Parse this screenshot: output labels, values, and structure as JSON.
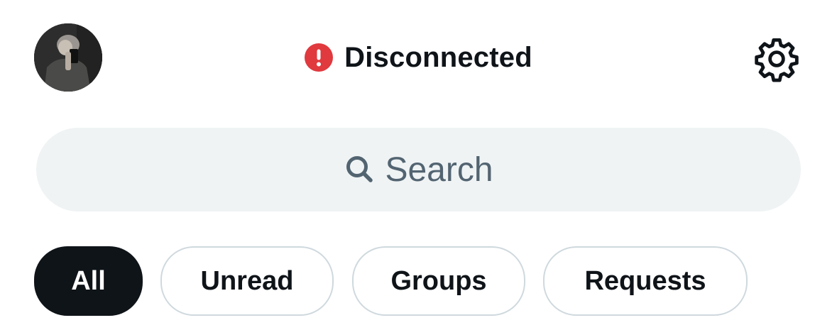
{
  "header": {
    "avatar_icon": "profile-photo",
    "status_text": "Disconnected",
    "status_icon": "alert-circle-icon",
    "status_color": "#e0393e",
    "settings_icon": "gear-icon"
  },
  "search": {
    "placeholder": "Search",
    "icon": "search-icon"
  },
  "filters": [
    {
      "label": "All",
      "active": true
    },
    {
      "label": "Unread",
      "active": false
    },
    {
      "label": "Groups",
      "active": false
    },
    {
      "label": "Requests",
      "active": false
    }
  ],
  "colors": {
    "text_primary": "#0f1419",
    "text_secondary": "#536471",
    "search_bg": "#eff3f4",
    "chip_border": "#cfd9de"
  }
}
